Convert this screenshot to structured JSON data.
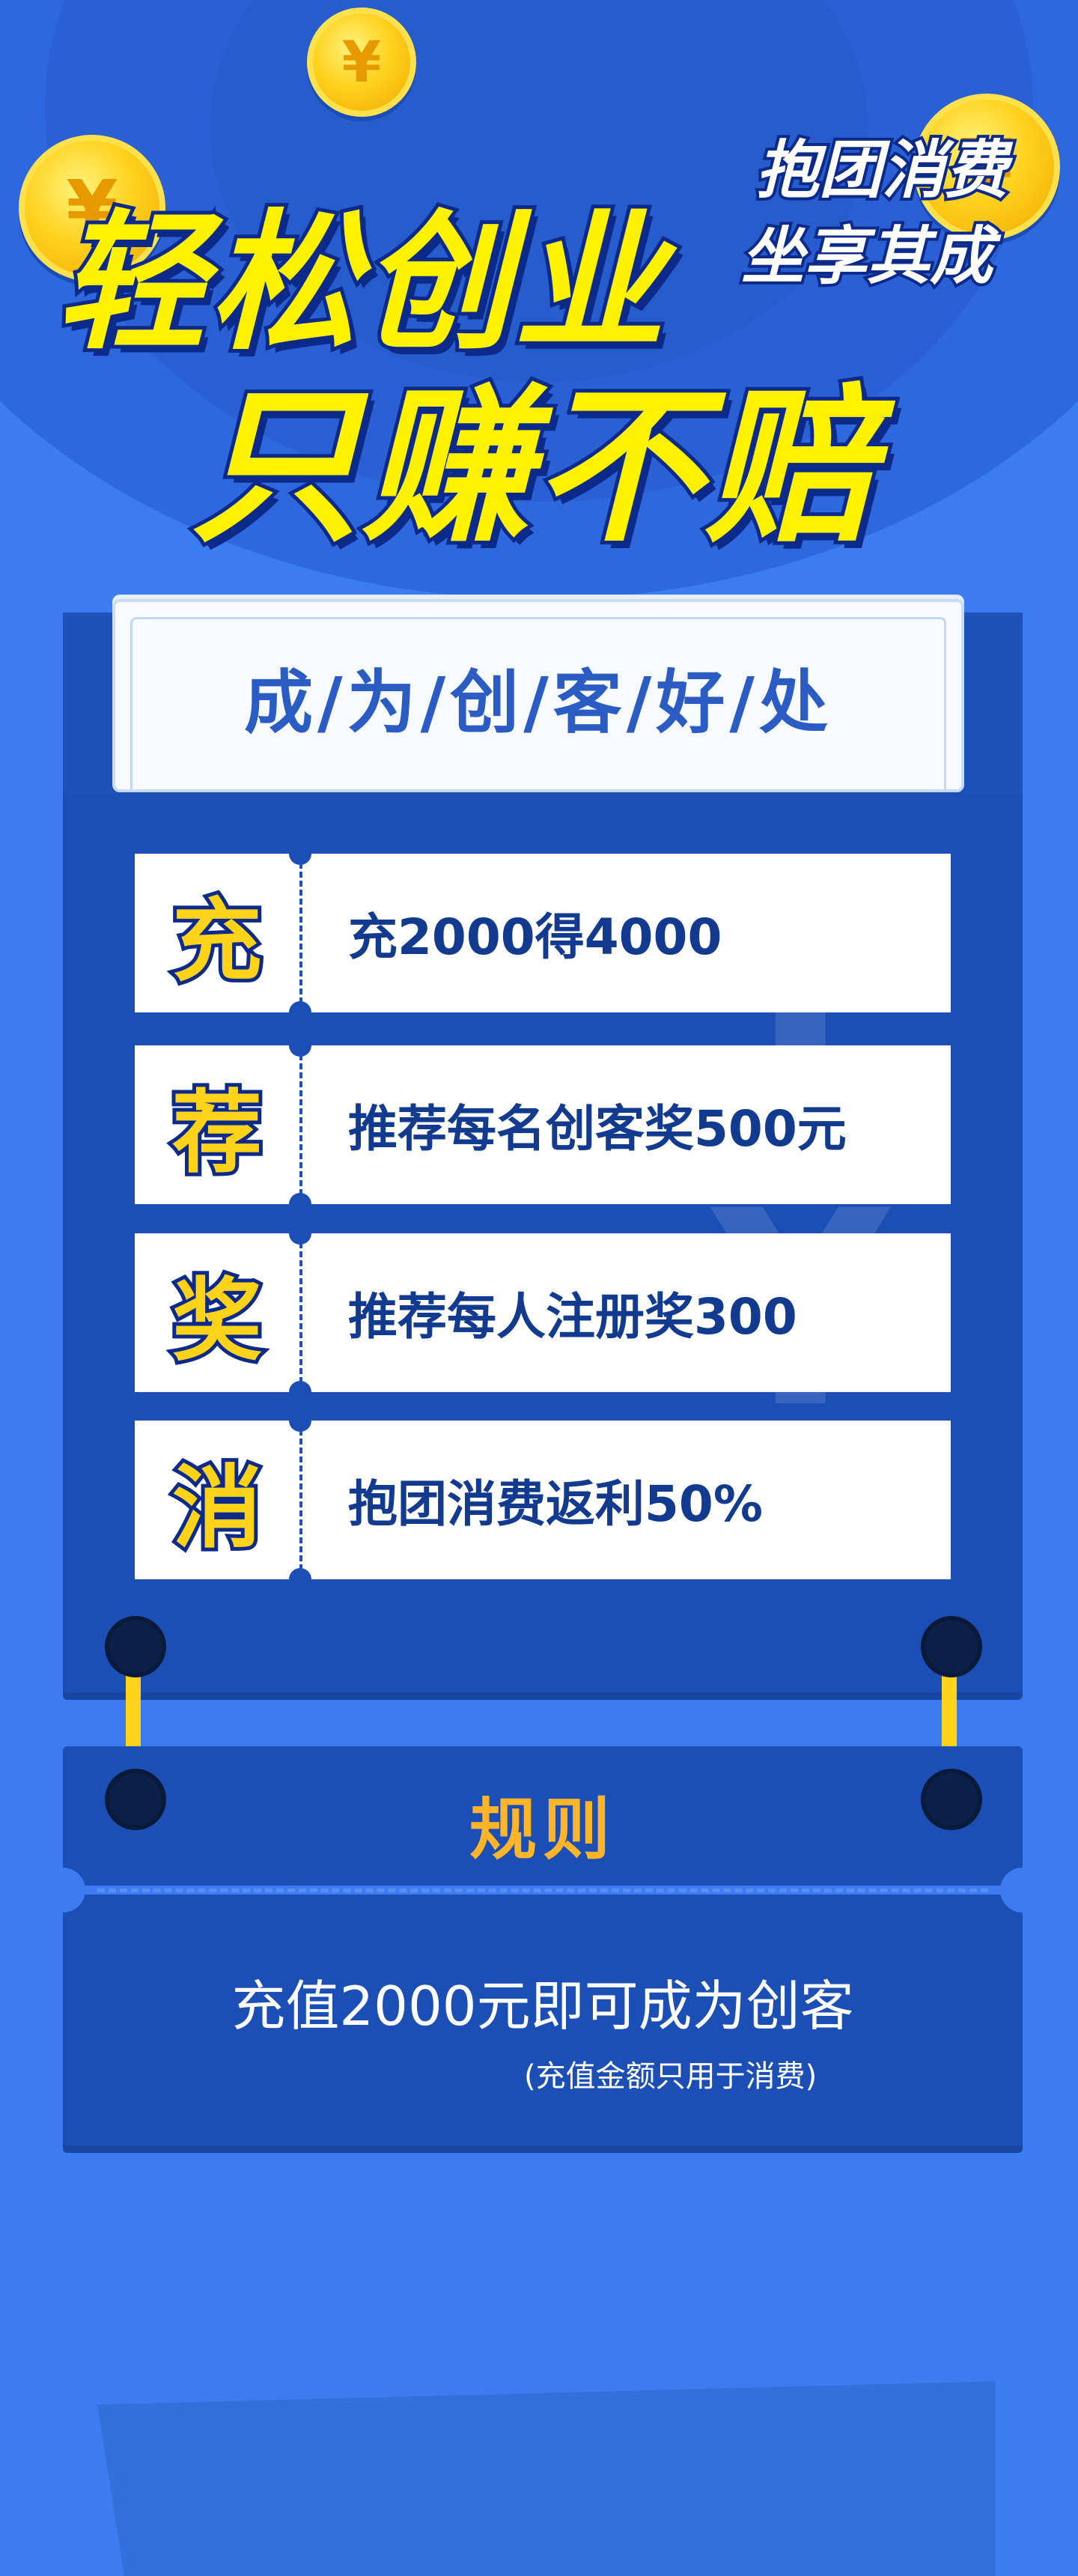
{
  "hero": {
    "line1": "轻松创业",
    "line2": "只赚不赔",
    "sub1": "抱团消费",
    "sub2": "坐享其成",
    "coin_symbol": "¥"
  },
  "benefits": {
    "title": "成/为/创/客/好/处",
    "watermark": "¥",
    "items": [
      {
        "icon": "充",
        "text": "充2000得4000"
      },
      {
        "icon": "荐",
        "text": "推荐每名创客奖500元"
      },
      {
        "icon": "奖",
        "text": "推荐每人注册奖300"
      },
      {
        "icon": "消",
        "text": "抱团消费返利50%"
      }
    ]
  },
  "rules": {
    "title": "规则",
    "main": "充值2000元即可成为创客",
    "note": "(充值金额只用于消费)"
  },
  "colors": {
    "background": "#3b7cf0",
    "card": "#1b4fb5",
    "accent_yellow": "#ffd31a",
    "title_orange": "#ffb42a",
    "text_navy": "#123a8e"
  }
}
